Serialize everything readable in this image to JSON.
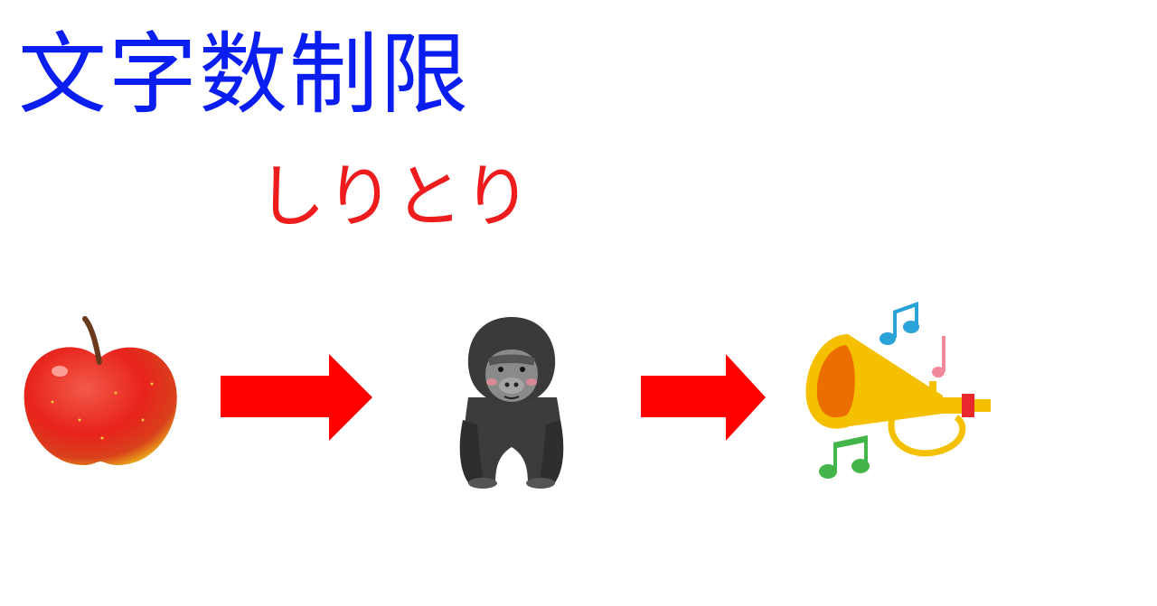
{
  "title": "文字数制限",
  "subtitle": "しりとり",
  "colors": {
    "title": "#0b1ef0",
    "subtitle": "#ee1c1c",
    "arrow": "#ff0000"
  },
  "sequence": [
    {
      "item": "apple-icon"
    },
    {
      "item": "arrow-right-icon"
    },
    {
      "item": "gorilla-icon"
    },
    {
      "item": "arrow-right-icon"
    },
    {
      "item": "trumpet-icon"
    }
  ]
}
